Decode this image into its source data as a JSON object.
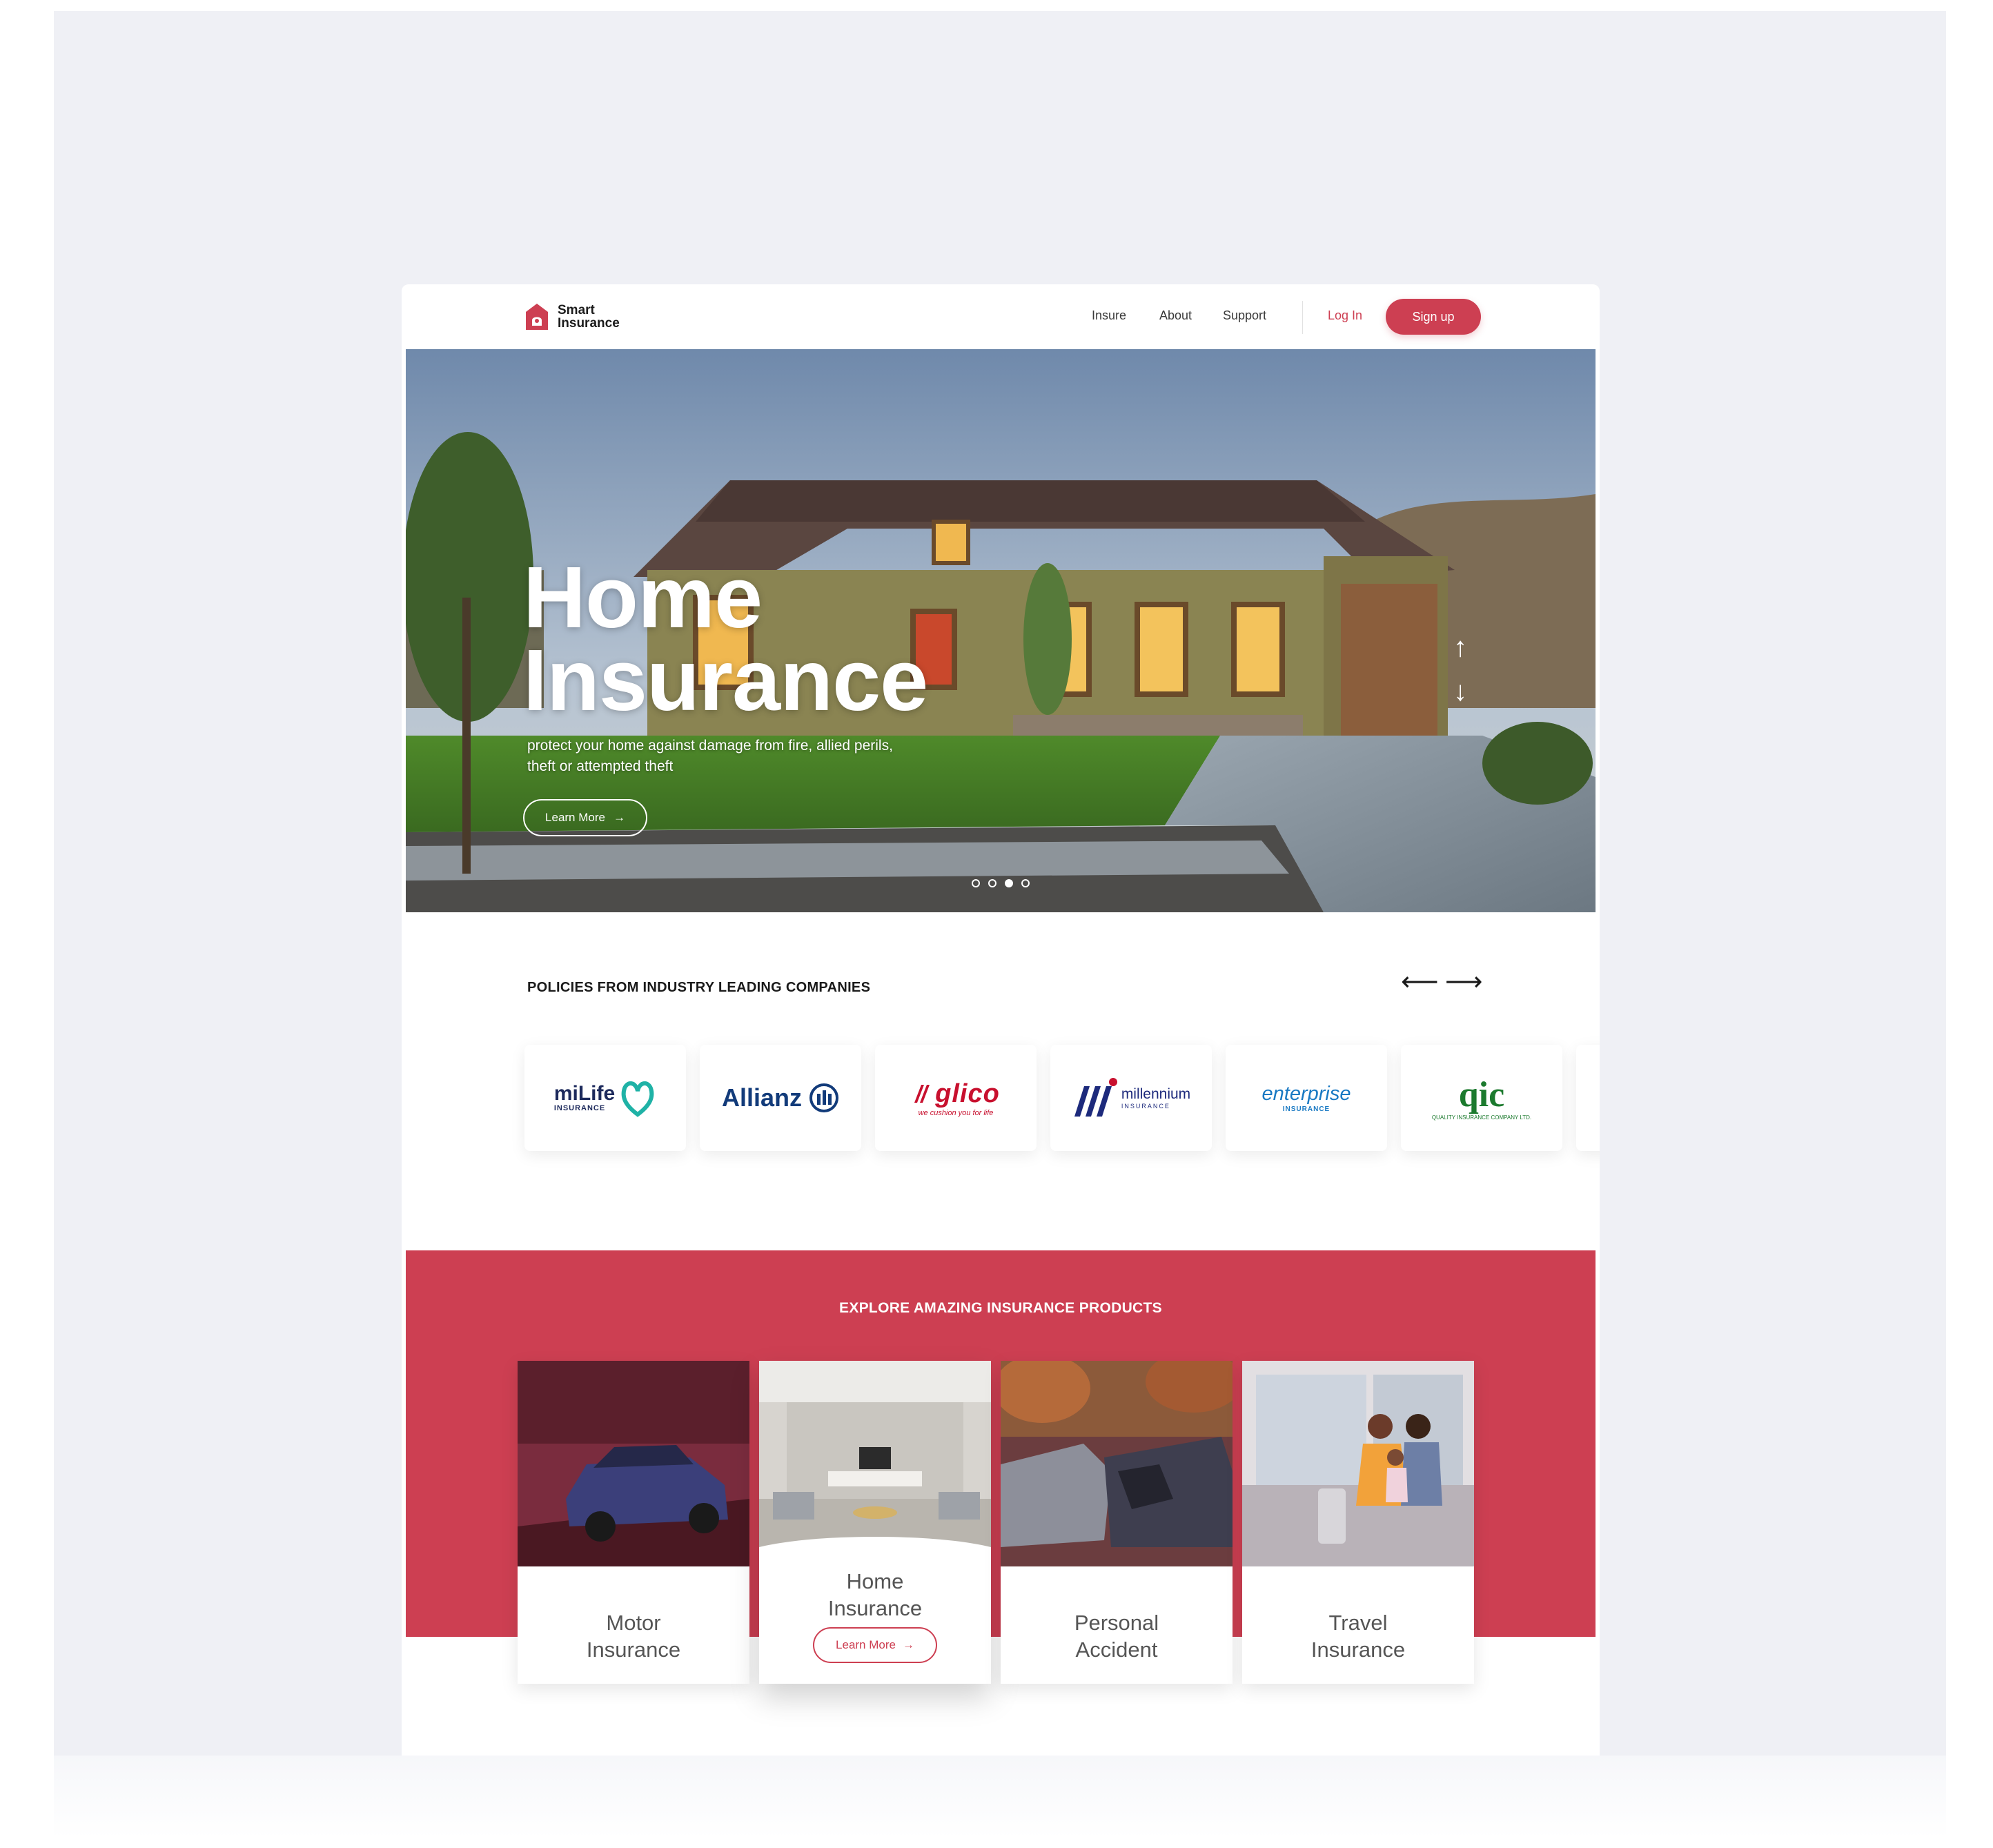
{
  "brand": {
    "line1": "Smart",
    "line2": "Insurance",
    "accent": "#cd3f52"
  },
  "nav": {
    "insure": "Insure",
    "about": "About",
    "support": "Support",
    "login": "Log In",
    "signup": "Sign up"
  },
  "hero": {
    "title_line1": "Home",
    "title_line2": "Insurance",
    "description": "protect your home against damage from fire, allied perils, theft or attempted theft",
    "button": "Learn More",
    "slides": 4,
    "active_slide": 3
  },
  "partners": {
    "title": "POLICIES FROM INDUSTRY LEADING COMPANIES",
    "logos": [
      {
        "name": "miLife",
        "sub": "INSURANCE"
      },
      {
        "name": "Allianz"
      },
      {
        "name": "Glico",
        "tagline": "we cushion you for life"
      },
      {
        "name": "millennium",
        "sub": "INSURANCE"
      },
      {
        "name": "enterprise",
        "sub": "INSURANCE"
      },
      {
        "name": "QIC",
        "sub": "QUALITY INSURANCE COMPANY LTD."
      }
    ]
  },
  "products": {
    "title": "EXPLORE AMAZING INSURANCE PRODUCTS",
    "items": [
      {
        "line1": "Motor",
        "line2": "Insurance"
      },
      {
        "line1": "Home",
        "line2": "Insurance",
        "button": "Learn More"
      },
      {
        "line1": "Personal",
        "line2": "Accident"
      },
      {
        "line1": "Travel",
        "line2": "Insurance"
      }
    ]
  }
}
